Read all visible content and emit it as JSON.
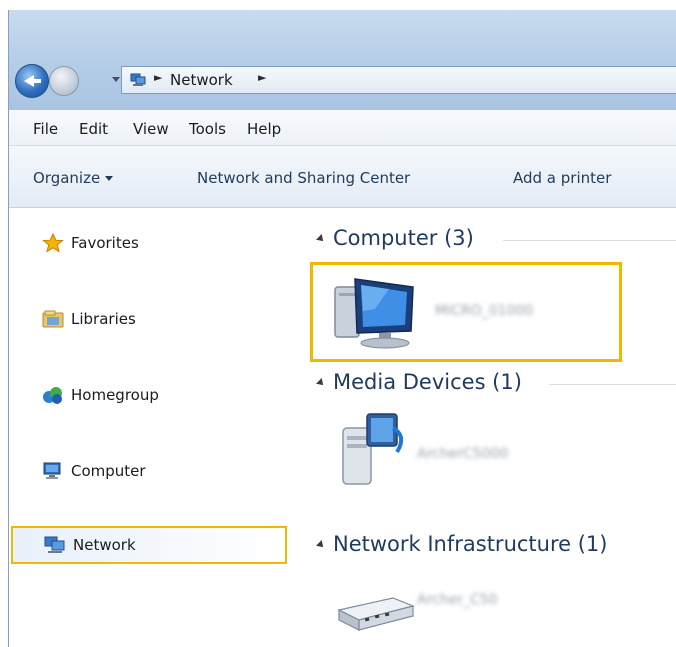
{
  "address_bar": {
    "breadcrumb": [
      "Network"
    ],
    "separator": "►"
  },
  "menu": [
    "File",
    "Edit",
    "View",
    "Tools",
    "Help"
  ],
  "command_bar": {
    "organize": "Organize",
    "network_sharing_center": "Network and Sharing Center",
    "add_printer": "Add a printer"
  },
  "nav_pane": {
    "items": [
      {
        "label": "Favorites",
        "icon": "star-icon"
      },
      {
        "label": "Libraries",
        "icon": "libraries-icon"
      },
      {
        "label": "Homegroup",
        "icon": "homegroup-icon"
      },
      {
        "label": "Computer",
        "icon": "computer-icon"
      },
      {
        "label": "Network",
        "icon": "network-icon",
        "selected": true
      }
    ]
  },
  "groups": [
    {
      "title": "Computer (3)",
      "devices": [
        {
          "name": "MICRO_01000",
          "icon": "computer-icon",
          "selected": true
        }
      ]
    },
    {
      "title": "Media Devices (1)",
      "devices": [
        {
          "name": "ArcherC5000",
          "icon": "media-device-icon"
        }
      ]
    },
    {
      "title": "Network Infrastructure (1)",
      "devices": [
        {
          "name": "Archer_C50",
          "icon": "router-icon"
        }
      ]
    }
  ],
  "colors": {
    "highlight": "#f0b800",
    "group_title": "#1e3a5f"
  }
}
